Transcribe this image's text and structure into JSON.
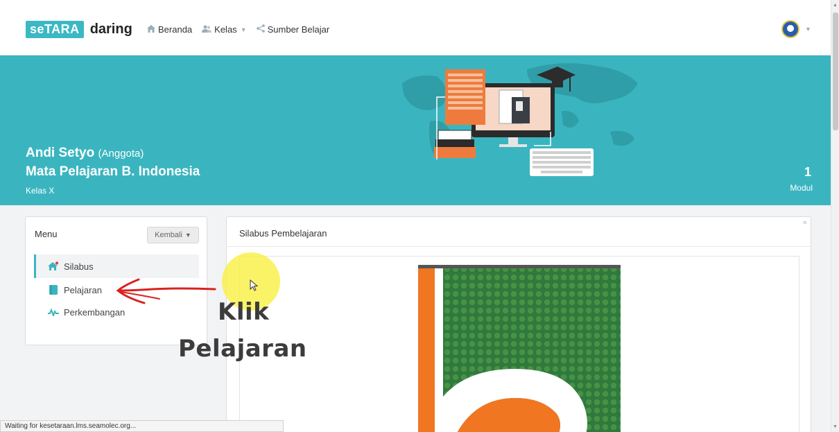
{
  "navbar": {
    "brand_box": "seTARA",
    "brand_suffix": "daring",
    "items": [
      {
        "label": "Beranda",
        "icon": "home-icon"
      },
      {
        "label": "Kelas",
        "icon": "users-icon",
        "has_dropdown": true
      },
      {
        "label": "Sumber Belajar",
        "icon": "share-icon"
      }
    ],
    "user_icon": "user-avatar-icon"
  },
  "hero": {
    "name": "Andi Setyo",
    "role": "(Anggota)",
    "subject": "Mata Pelajaran B. Indonesia",
    "class": "Kelas X",
    "module_count": "1",
    "module_label": "Modul",
    "background_color": "#3ab5c0"
  },
  "menu": {
    "title": "Menu",
    "back_button": "Kembali",
    "items": [
      {
        "label": "Silabus",
        "icon": "home-icon",
        "active": true
      },
      {
        "label": "Pelajaran",
        "icon": "book-icon",
        "active": false
      },
      {
        "label": "Perkembangan",
        "icon": "chart-icon",
        "active": false
      }
    ]
  },
  "content": {
    "title": "Silabus Pembelajaran",
    "corner_mark": "n"
  },
  "annotation": {
    "line1": "Klik",
    "line2": "Pelajaran",
    "arrow_color": "#d8231f",
    "highlight_color": "#faf046"
  },
  "status_bar": {
    "text": "Waiting for kesetaraan.lms.seamolec.org..."
  }
}
